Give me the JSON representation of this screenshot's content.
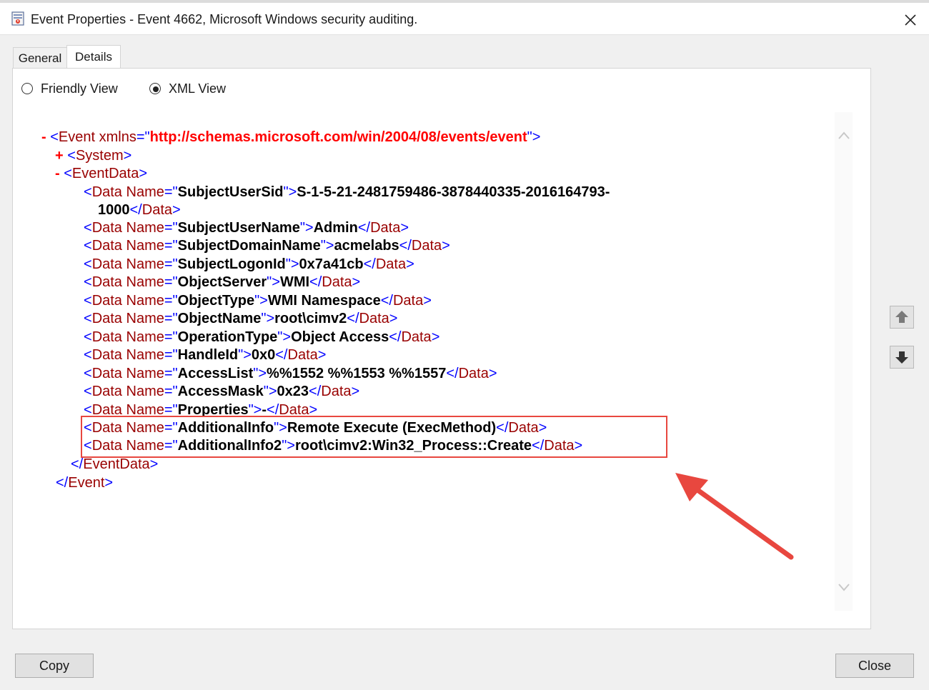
{
  "window": {
    "title": "Event Properties - Event 4662, Microsoft Windows security auditing."
  },
  "tabs": [
    {
      "label": "General",
      "selected": false
    },
    {
      "label": "Details",
      "selected": true
    }
  ],
  "view_options": {
    "friendly": {
      "label": "Friendly View",
      "selected": false
    },
    "xml": {
      "label": "XML View",
      "selected": true
    }
  },
  "xml": {
    "root_tag": "Event",
    "xmlns_attr": "xmlns",
    "xmlns_value": "http://schemas.microsoft.com/win/2004/08/events/event",
    "system_tag": "System",
    "eventdata_tag": "EventData",
    "data_tag": "Data",
    "name_attr": "Name",
    "collapse_symbol": "-",
    "expand_symbol": "+",
    "subject_user_sid_name": "SubjectUserSid",
    "subject_user_sid_value": "S-1-5-21-2481759486-3878440335-2016164793-",
    "subject_user_sid_value_cont": "1000",
    "data_items": [
      {
        "name": "SubjectUserName",
        "value": "Admin"
      },
      {
        "name": "SubjectDomainName",
        "value": "acmelabs"
      },
      {
        "name": "SubjectLogonId",
        "value": "0x7a41cb"
      },
      {
        "name": "ObjectServer",
        "value": "WMI"
      },
      {
        "name": "ObjectType",
        "value": "WMI Namespace"
      },
      {
        "name": "ObjectName",
        "value": "root\\cimv2"
      },
      {
        "name": "OperationType",
        "value": "Object Access"
      },
      {
        "name": "HandleId",
        "value": "0x0"
      },
      {
        "name": "AccessList",
        "value": "%%1552 %%1553 %%1557"
      },
      {
        "name": "AccessMask",
        "value": "0x23"
      },
      {
        "name": "Properties",
        "value": "-"
      },
      {
        "name": "AdditionalInfo",
        "value": "Remote Execute (ExecMethod)"
      },
      {
        "name": "AdditionalInfo2",
        "value": "root\\cimv2:Win32_Process::Create"
      }
    ]
  },
  "buttons": {
    "copy": "Copy",
    "close": "Close"
  },
  "colors": {
    "highlight": "#e8473f",
    "tag_bracket": "#0000ff",
    "tag_name": "#990000",
    "namespace": "#ff0000"
  },
  "icons": {
    "window": "event-viewer-icon",
    "close": "close-icon",
    "nav_up": "arrow-up-icon",
    "nav_down": "arrow-down-icon"
  }
}
